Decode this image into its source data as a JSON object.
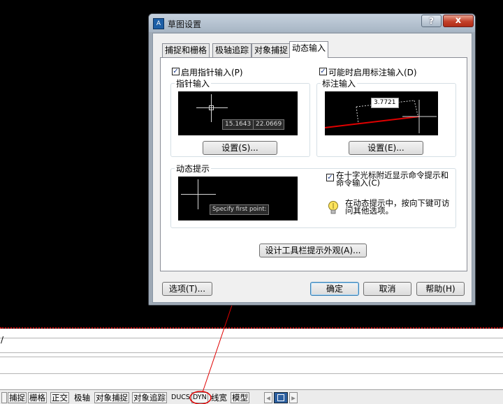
{
  "dialog": {
    "title": "草图设置",
    "help_glyph": "?",
    "close_glyph": "x",
    "tabs": [
      {
        "label": "捕捉和栅格",
        "active": false
      },
      {
        "label": "极轴追踪",
        "active": false
      },
      {
        "label": "对象捕捉",
        "active": false
      },
      {
        "label": "动态输入",
        "active": true
      }
    ],
    "pointer_input": {
      "enable_label": "启用指针输入(P)",
      "enable_checked": true,
      "group_title": "指针输入",
      "readout_x": "15.1643",
      "readout_y": "22.0669",
      "settings_button": "设置(S)..."
    },
    "dimension_input": {
      "enable_label": "可能时启用标注输入(D)",
      "enable_checked": true,
      "group_title": "标注输入",
      "readout_value": "3.7721",
      "settings_button": "设置(E)..."
    },
    "dynamic_prompts": {
      "group_title": "动态提示",
      "preview_prompt": "Specify first point:",
      "show_prompts_label": "在十字光标附近显示命令提示和命令输入(C)",
      "show_prompts_checked": true,
      "tip_text": "在动态提示中，按向下键可访问其他选项。"
    },
    "tooltip_appearance_button": "设计工具栏提示外观(A)...",
    "options_button": "选项(T)...",
    "ok_button": "确定",
    "cancel_button": "取消",
    "help_button": "帮助(H)"
  },
  "command_line": {
    "text": "/"
  },
  "status_bar": {
    "buttons": [
      {
        "label": "捕捉"
      },
      {
        "label": "栅格"
      },
      {
        "label": "正交"
      },
      {
        "label": "极轴"
      },
      {
        "label": "对象捕捉"
      },
      {
        "label": "对象追踪"
      },
      {
        "label": "DUCS"
      },
      {
        "label": "DYN"
      },
      {
        "label": "线宽"
      },
      {
        "label": "模型"
      }
    ]
  },
  "colors": {
    "annotation": "#e00000",
    "accent": "#3c7fb1"
  }
}
